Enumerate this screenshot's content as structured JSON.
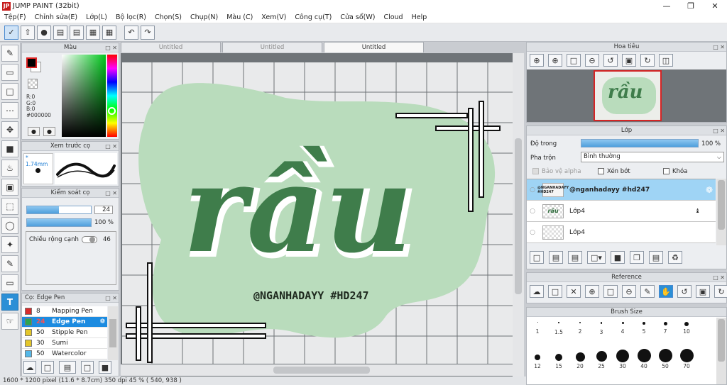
{
  "window": {
    "title": "JUMP PAINT (32bit)",
    "app_icon": "JP"
  },
  "menu": [
    "Tệp(F)",
    "Chỉnh sửa(E)",
    "Lớp(L)",
    "Bộ lọc(R)",
    "Chọn(S)",
    "Chụp(N)",
    "Màu (C)",
    "Xem(V)",
    "Công cụ(T)",
    "Cửa sổ(W)",
    "Cloud",
    "Help"
  ],
  "tabs": [
    "Untitled",
    "Untitled",
    "Untitled"
  ],
  "color_panel": {
    "title": "Màu",
    "r": "R:0",
    "g": "G:0",
    "b": "B:0",
    "hex": "#000000"
  },
  "brush_preview": {
    "title": "Xem trước cọ",
    "size": "* 1.74mm"
  },
  "brush_control": {
    "title": "Kiểm soát cọ",
    "size_value": "24",
    "size_fraction": 0.5,
    "opacity_value": "100 %",
    "opacity_fraction": 1.0,
    "edge_label": "Chiều rộng cạnh",
    "edge_value": "46"
  },
  "brush_list": {
    "title": "Cọ: Edge Pen",
    "items": [
      {
        "num": "8",
        "name": "Mapping Pen",
        "color": "#d92c2c"
      },
      {
        "num": "24",
        "name": "Edge Pen",
        "color": "#2da44e"
      },
      {
        "num": "50",
        "name": "Stipple Pen",
        "color": "#e3c62a"
      },
      {
        "num": "30",
        "name": "Sumi",
        "color": "#e3c62a"
      },
      {
        "num": "50",
        "name": "Watercolor",
        "color": "#55b8e8"
      }
    ]
  },
  "artwork": {
    "main_text": "rầu",
    "tag": "@NGANHADAYY #HD247",
    "blob_color": "#b9dcbc",
    "letter_color": "#3f7d4b"
  },
  "navigator": {
    "title": "Hoa tiêu"
  },
  "layers_panel": {
    "title": "Lớp",
    "opacity_label": "Độ trong",
    "opacity_value": "100 %",
    "opacity_fraction": 1.0,
    "blend_label": "Pha trộn",
    "blend_value": "Bình thường",
    "protect_alpha": "Bảo vệ alpha",
    "clipping": "Xén bớt",
    "lock": "Khóa",
    "layers": [
      {
        "name": "@nganhadayy #hd247",
        "thumb_text": "@NGANHADAYY #HD247"
      },
      {
        "name": "Lớp4",
        "thumb_text": "rầu"
      },
      {
        "name": "Lớp4",
        "thumb_text": ""
      }
    ]
  },
  "reference": {
    "title": "Reference"
  },
  "brush_size": {
    "title": "Brush Size",
    "row1": [
      "1",
      "1.5",
      "2",
      "3",
      "4",
      "5",
      "7",
      "10"
    ],
    "row2": [
      "12",
      "15",
      "20",
      "25",
      "30",
      "40",
      "50",
      "70"
    ]
  },
  "status": {
    "text": "1600 * 1200 pixel   (11.6 * 8.7cm)  350 dpi   45 %   ( 540, 938 )"
  }
}
